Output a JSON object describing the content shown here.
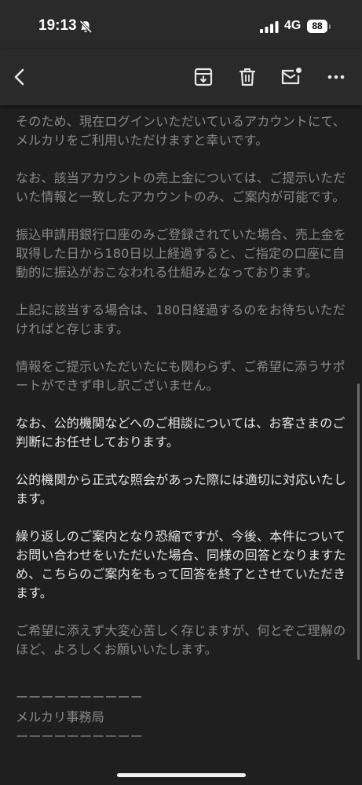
{
  "status_bar": {
    "time": "19:13",
    "network": "4G",
    "battery": "88"
  },
  "toolbar": {
    "back": "back",
    "archive": "archive",
    "delete": "delete",
    "mark_unread": "mark-unread",
    "more": "more"
  },
  "email": {
    "paragraphs": [
      "そのため、現在ログインいただいているアカウントにて、メルカリをご利用いただけますと幸いです。",
      "なお、該当アカウントの売上金については、ご提示いただいた情報と一致したアカウントのみ、ご案内が可能です。",
      "振込申請用銀行口座のみご登録されていた場合、売上金を取得した日から180日以上経過すると、ご指定の口座に自動的に振込がおこなわれる仕組みとなっております。",
      "上記に該当する場合は、180日経過するのをお待ちいただければと存じます。",
      "情報をご提示いただいたにも関わらず、ご希望に添うサポートができず申し訳ございません。",
      "なお、公的機関などへのご相談については、お客さまのご判断にお任せしております。",
      "公的機関から正式な照会があった際には適切に対応いたします。",
      "繰り返しのご案内となり恐縮ですが、今後、本件についてお問い合わせをいただいた場合、同様の回答となりますため、こちらのご案内をもって回答を終了とさせていただきます。",
      "ご希望に添えず大変心苦しく存じますが、何とぞご理解のほど、よろしくお願いいたします。"
    ],
    "signature": {
      "divider_top": "ーーーーーーーーーー",
      "sender": "メルカリ事務局",
      "divider_bottom": "ーーーーーーーーーー"
    }
  },
  "colors": {
    "background": "#1f1f1f",
    "header": "#2a2a2a",
    "text_bright": "#e6e6e6",
    "text_dim": "#8a8a8a"
  }
}
